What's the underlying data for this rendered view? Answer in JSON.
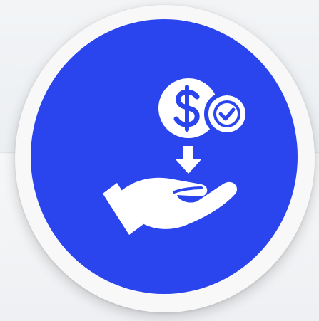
{
  "badge": {
    "icon": "receive-payment-icon",
    "ring_color": "#f8f8f8",
    "disc_color": "#2a45ee",
    "glyph_color": "#ffffff"
  }
}
